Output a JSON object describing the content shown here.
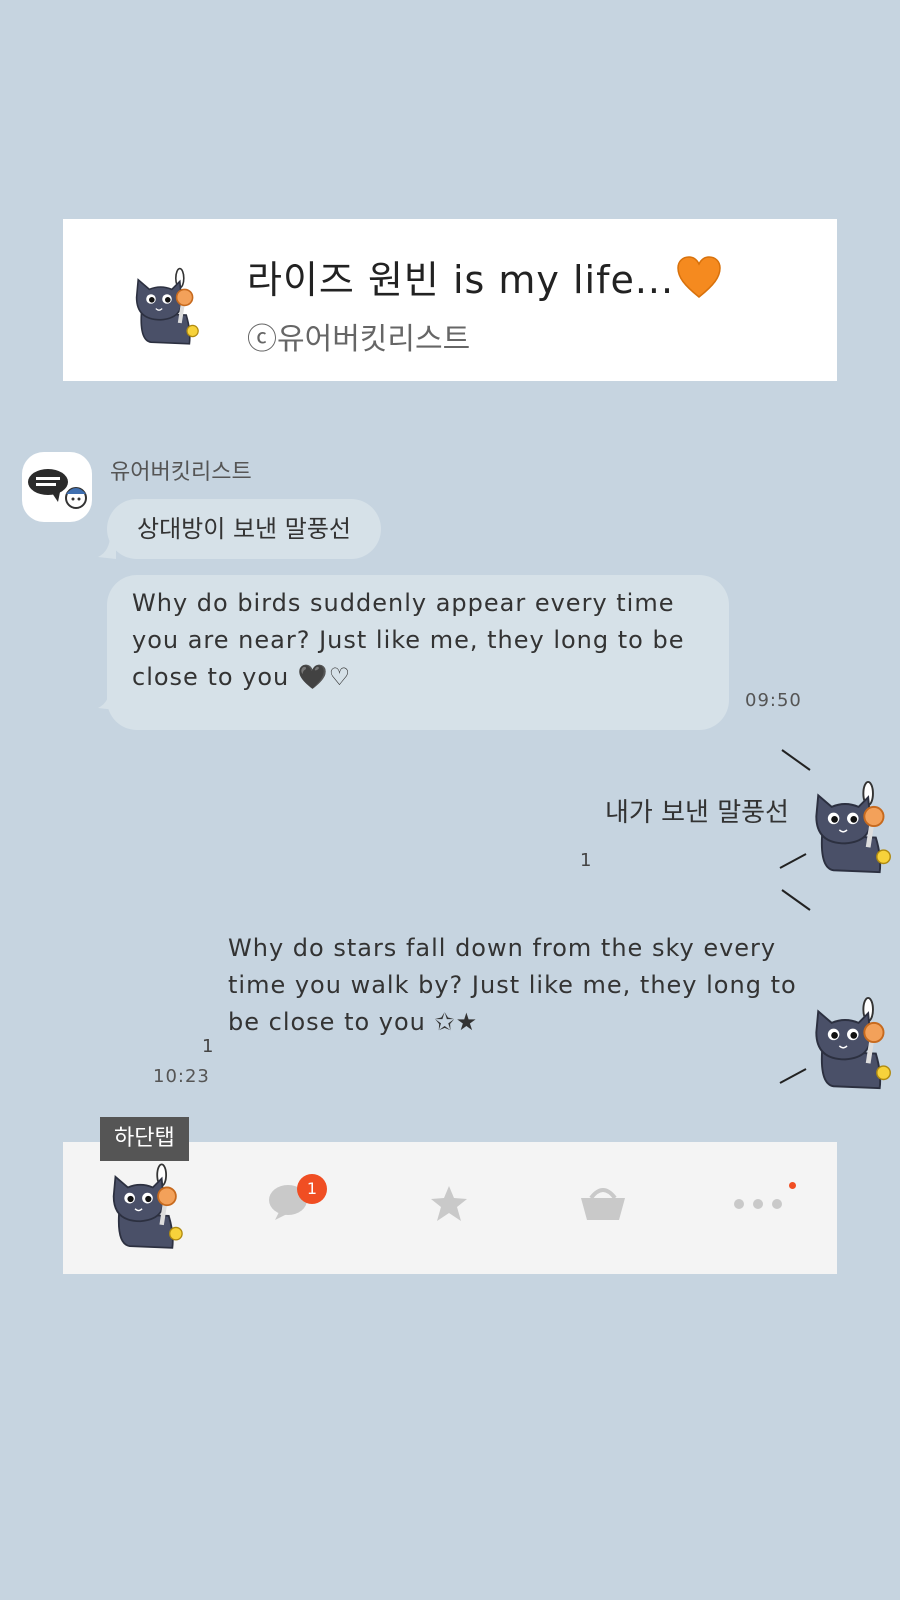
{
  "header": {
    "title": "라이즈 원빈 is my life...",
    "title_emoji": "orange-heart-icon",
    "subtitle": "ⓒ유어버킷리스트"
  },
  "chat": {
    "sender": "유어버킷리스트",
    "incoming": [
      {
        "text": "상대방이 보낸 말풍선"
      },
      {
        "text": "Why do birds suddenly appear every time you are near? Just like me, they long to be close to you 🖤♡",
        "time": "09:50"
      }
    ],
    "outgoing": [
      {
        "text": "내가 보낸 말풍선",
        "read_count": "1"
      },
      {
        "text": "Why do stars fall down from the sky every time you walk by? Just like me, they long to be close to you ✩★",
        "read_count": "1",
        "time": "10:23"
      }
    ]
  },
  "bottom_tab": {
    "label": "하단탭",
    "tabs": [
      {
        "name": "friends",
        "icon": "cat-profile-icon"
      },
      {
        "name": "chats",
        "icon": "chat-bubble-icon",
        "badge": "1"
      },
      {
        "name": "view",
        "icon": "star-icon"
      },
      {
        "name": "shopping",
        "icon": "basket-icon"
      },
      {
        "name": "more",
        "icon": "more-dots-icon",
        "has_dot": true
      }
    ]
  },
  "colors": {
    "background": "#c6d4e0",
    "bubble": "#d6e1e8",
    "badge": "#f04e23",
    "tabbar": "#f4f4f4"
  }
}
